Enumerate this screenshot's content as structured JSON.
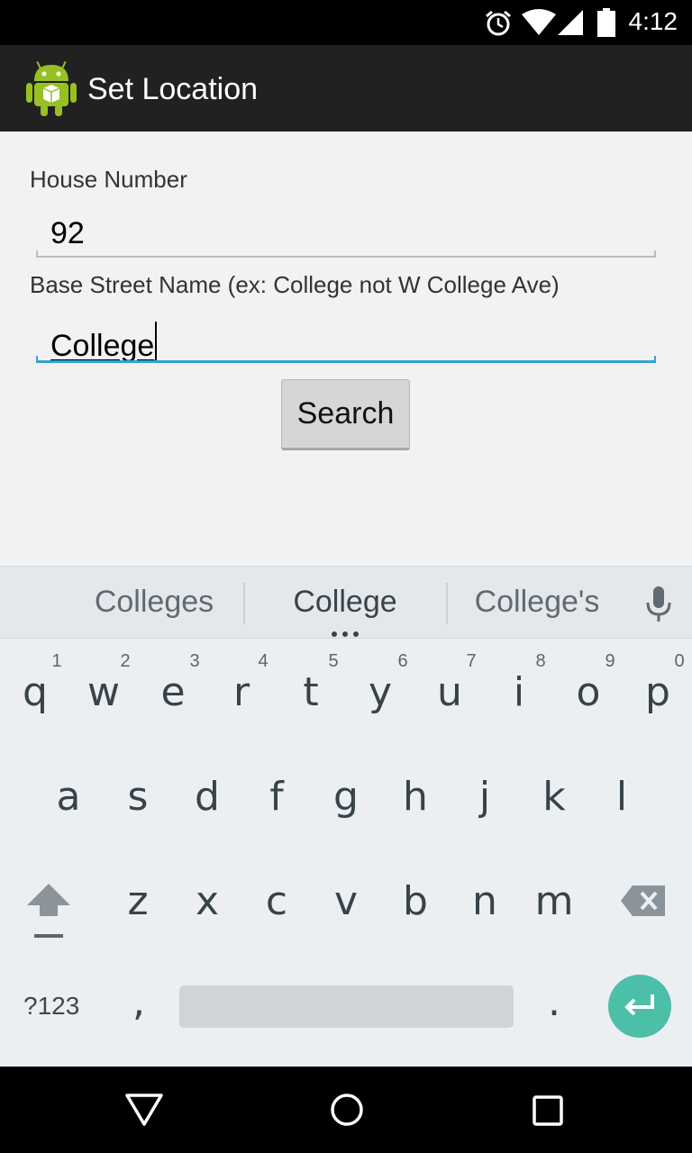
{
  "status_bar": {
    "time": "4:12"
  },
  "app": {
    "title": "Set Location"
  },
  "form": {
    "house_number_label": "House Number",
    "house_number_value": "92",
    "street_label": "Base Street Name (ex: College not W College Ave)",
    "street_value": "College",
    "search_label": "Search"
  },
  "keyboard": {
    "suggestions": [
      "Colleges",
      "College",
      "College's"
    ],
    "row1": [
      "q",
      "w",
      "e",
      "r",
      "t",
      "y",
      "u",
      "i",
      "o",
      "p"
    ],
    "row1_hints": [
      "1",
      "2",
      "3",
      "4",
      "5",
      "6",
      "7",
      "8",
      "9",
      "0"
    ],
    "row2": [
      "a",
      "s",
      "d",
      "f",
      "g",
      "h",
      "j",
      "k",
      "l"
    ],
    "row3": [
      "z",
      "x",
      "c",
      "v",
      "b",
      "n",
      "m"
    ],
    "symbols_label": "?123",
    "comma": ",",
    "period": "."
  },
  "colors": {
    "accent": "#33a3d4",
    "enter": "#4bbfa8",
    "action_bar": "#212121"
  }
}
